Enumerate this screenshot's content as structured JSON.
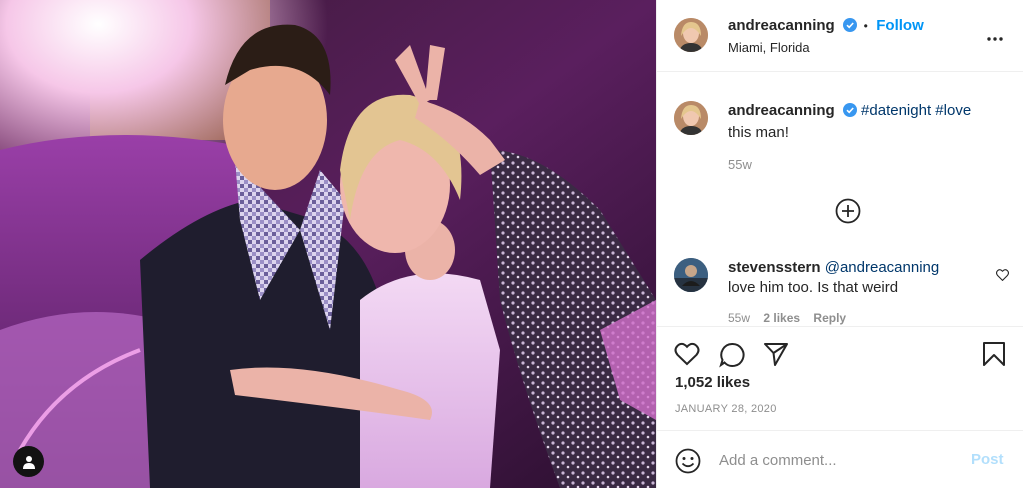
{
  "post": {
    "author": "andreacanning",
    "follow_label": "Follow",
    "separator": "•",
    "location": "Miami, Florida"
  },
  "caption": {
    "author": "andreacanning",
    "tag1": "#datenight",
    "tag2": "#love",
    "text": "this man!",
    "time": "55w"
  },
  "comment": {
    "author": "stevensstern",
    "mention": "@andreacanning",
    "text": "love him too. Is that weird",
    "time": "55w",
    "likes": "2 likes",
    "reply_label": "Reply"
  },
  "likes_label": "1,052 likes",
  "date": "JANUARY 28, 2020",
  "composer": {
    "placeholder": "Add a comment...",
    "post_label": "Post"
  },
  "colors": {
    "accent": "#0095f6",
    "hashtag": "#00376b",
    "muted": "#8e8e8e",
    "post_disabled": "#b2dffc"
  },
  "icons": {
    "verified": "verified-badge-icon",
    "more": "more-options-icon",
    "load_more": "plus-circle-icon",
    "like": "heart-icon",
    "comment": "comment-icon",
    "share": "share-icon",
    "save": "bookmark-icon",
    "emoji": "emoji-icon",
    "tagged_users": "user-icon"
  }
}
